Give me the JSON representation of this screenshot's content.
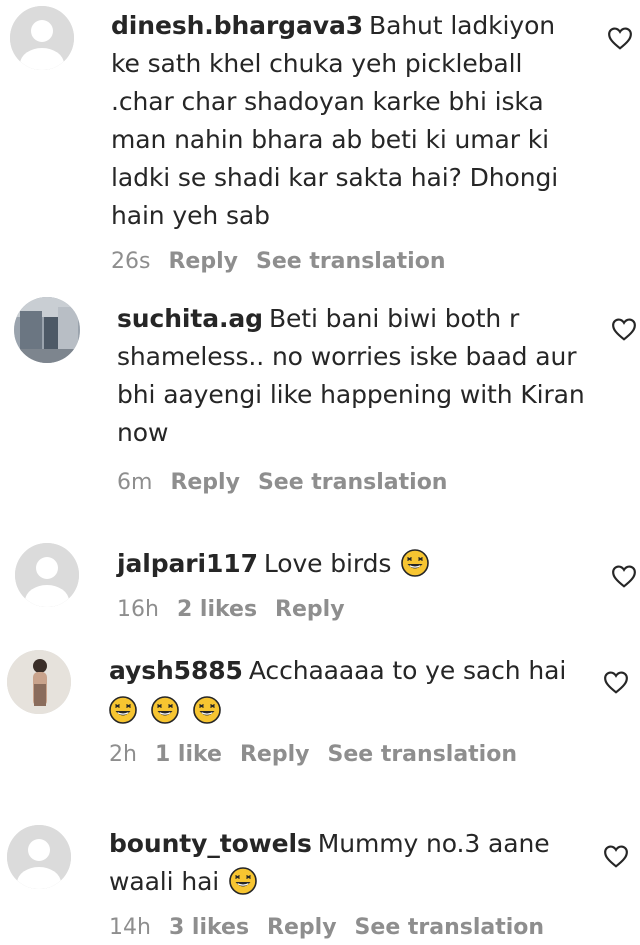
{
  "colors": {
    "text": "#262626",
    "meta": "#8e8e8e",
    "avatar_default": "#dbdbdb",
    "emoji_face": "#f7c531"
  },
  "comments": [
    {
      "username": "dinesh.bhargava3",
      "text": "Bahut ladkiyon ke sath khel chuka yeh pickleball .char char shadoyan karke bhi iska man nahin bhara ab beti ki umar ki ladki se shadi kar sakta hai? Dhongi hain yeh sab",
      "time": "26s",
      "likes": "",
      "reply": "Reply",
      "translation": "See translation",
      "avatar": "default-avatar-icon"
    },
    {
      "username": "suchita.ag",
      "text": "Beti bani biwi both r shameless.. no worries iske baad aur bhi aayengi like happening with Kiran now",
      "time": "6m",
      "likes": "",
      "reply": "Reply",
      "translation": "See translation",
      "avatar": "photo-avatar"
    },
    {
      "username": "jalpari117",
      "text": "Love birds",
      "time": "16h",
      "likes": "2 likes",
      "reply": "Reply",
      "translation": "",
      "avatar": "default-avatar-icon"
    },
    {
      "username": "aysh5885",
      "text": "Acchaaaaa to ye sach hai",
      "time": "2h",
      "likes": "1 like",
      "reply": "Reply",
      "translation": "See translation",
      "avatar": "photo-avatar"
    },
    {
      "username": "bounty_towels",
      "text": "Mummy no.3 aane waali hai",
      "time": "14h",
      "likes": "3 likes",
      "reply": "Reply",
      "translation": "See translation",
      "avatar": "default-avatar-icon"
    }
  ]
}
